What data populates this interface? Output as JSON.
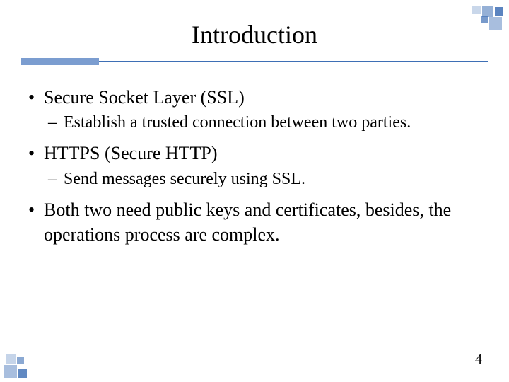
{
  "title": "Introduction",
  "bullets": [
    {
      "text": "Secure Socket Layer (SSL)",
      "sub": [
        "Establish a trusted connection between two parties."
      ]
    },
    {
      "text": "HTTPS (Secure HTTP)",
      "sub": [
        "Send messages securely using SSL."
      ]
    },
    {
      "text": "Both two need public keys and certificates, besides, the operations process are complex.",
      "sub": []
    }
  ],
  "page_number": "4",
  "glyphs": {
    "bullet_dot": "•",
    "sub_dash": "–"
  }
}
